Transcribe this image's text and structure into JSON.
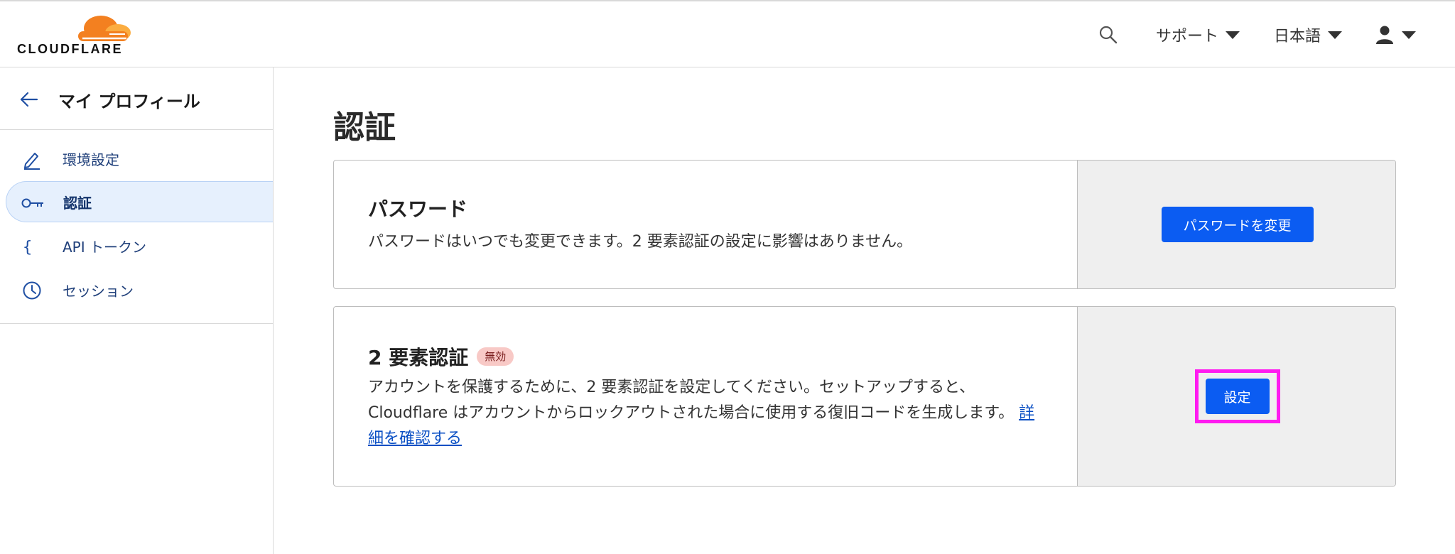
{
  "header": {
    "logo_text": "CLOUDFLARE",
    "support_label": "サポート",
    "language_label": "日本語",
    "brand_colors": {
      "orange": "#F38020",
      "light_orange": "#FBAD41"
    }
  },
  "sidebar": {
    "title": "マイ プロフィール",
    "items": [
      {
        "label": "環境設定",
        "icon": "pencil-icon",
        "active": false
      },
      {
        "label": "認証",
        "icon": "key-icon",
        "active": true
      },
      {
        "label": "API トークン",
        "icon": "braces-icon",
        "active": false
      },
      {
        "label": "セッション",
        "icon": "clock-icon",
        "active": false
      }
    ]
  },
  "main": {
    "title": "認証",
    "password_card": {
      "title": "パスワード",
      "description": "パスワードはいつでも変更できます。2 要素認証の設定に影響はありません。",
      "button_label": "パスワードを変更"
    },
    "twofa_card": {
      "title": "2 要素認証",
      "status_badge": "無効",
      "description": "アカウントを保護するために、2 要素認証を設定してください。セットアップすると、Cloudflare はアカウントからロックアウトされた場合に使用する復旧コードを生成します。",
      "link_label": "詳細を確認する",
      "button_label": "設定"
    }
  },
  "colors": {
    "primary_button": "#0B5CF2",
    "highlight": "#FF1BF0",
    "badge_bg": "#F8C9C6",
    "active_nav_bg": "#E6F0FD"
  }
}
